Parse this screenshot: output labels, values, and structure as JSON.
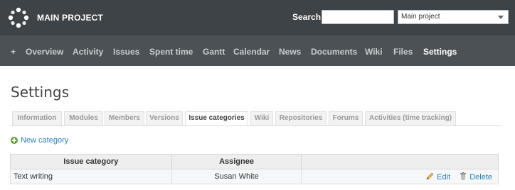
{
  "header": {
    "project_title": "MAIN PROJECT",
    "search_label": "Search:",
    "search_value": "",
    "project_select_value": "Main project"
  },
  "menu": {
    "items": [
      {
        "label": "+"
      },
      {
        "label": "Overview"
      },
      {
        "label": "Activity"
      },
      {
        "label": "Issues"
      },
      {
        "label": "Spent time"
      },
      {
        "label": "Gantt"
      },
      {
        "label": "Calendar"
      },
      {
        "label": "News"
      },
      {
        "label": "Documents"
      },
      {
        "label": "Wiki"
      },
      {
        "label": "Files"
      },
      {
        "label": "Settings"
      }
    ],
    "active": "Settings"
  },
  "page": {
    "title": "Settings"
  },
  "tabs": [
    {
      "label": "Information"
    },
    {
      "label": "Modules"
    },
    {
      "label": "Members"
    },
    {
      "label": "Versions"
    },
    {
      "label": "Issue categories"
    },
    {
      "label": "Wiki"
    },
    {
      "label": "Repositories"
    },
    {
      "label": "Forums"
    },
    {
      "label": "Activities (time tracking)"
    }
  ],
  "active_tab": "Issue categories",
  "new_category": {
    "label": "New category",
    "icon": "plus-circle-icon"
  },
  "table": {
    "headers": [
      "Issue category",
      "Assignee",
      ""
    ],
    "rows": [
      {
        "category": "Text writing",
        "assignee": "Susan White",
        "edit_label": "Edit",
        "delete_label": "Delete"
      }
    ]
  },
  "colors": {
    "topbar": "#3e4347",
    "menubar": "#4b5155",
    "link": "#2980b9",
    "add_icon": "#5aa02c"
  }
}
